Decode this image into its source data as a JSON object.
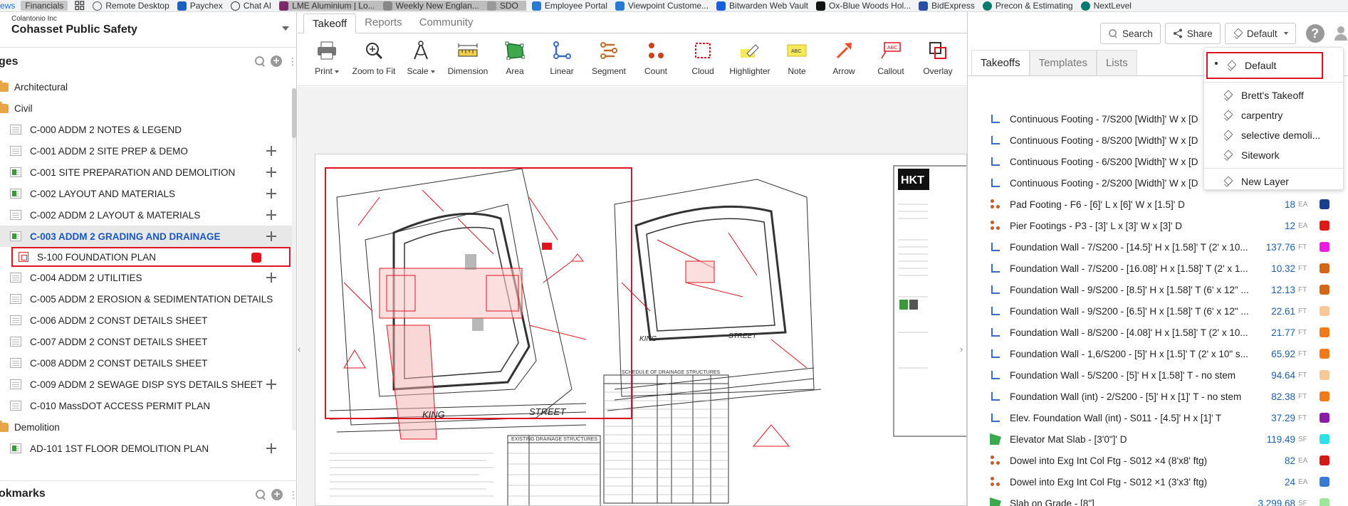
{
  "bookmarks": {
    "left_fragment": "ews",
    "items": [
      {
        "label": "Financials",
        "selected": true
      },
      {
        "label": "Remote Desktop"
      },
      {
        "label": "Paychex"
      },
      {
        "label": "Chat AI"
      },
      {
        "label": "LME Aluminium | Lo..."
      },
      {
        "label": "Weekly New Englan..."
      },
      {
        "label": "SDO"
      },
      {
        "label": "Employee Portal"
      },
      {
        "label": "Viewpoint Custome..."
      },
      {
        "label": "Bitwarden Web Vault"
      },
      {
        "label": "Ox-Blue Woods Hol..."
      },
      {
        "label": "BidExpress"
      },
      {
        "label": "Precon & Estimating"
      },
      {
        "label": "NextLevel"
      }
    ]
  },
  "project": {
    "company": "Colantonio Inc",
    "name": "Cohasset Public Safety"
  },
  "pages_section": {
    "title": "ges"
  },
  "bookmarks_section": {
    "title": "okmarks"
  },
  "pages": [
    {
      "type": "folder",
      "label": "Architectural"
    },
    {
      "type": "folder",
      "label": "Civil"
    },
    {
      "type": "sheet",
      "label": "C-000 ADDM 2 NOTES & LEGEND",
      "green": false,
      "move": false
    },
    {
      "type": "sheet",
      "label": "C-001 ADDM 2 SITE PREP & DEMO",
      "green": false,
      "move": true
    },
    {
      "type": "sheet",
      "label": "C-001 SITE PREPARATION AND DEMOLITION",
      "green": true,
      "move": true
    },
    {
      "type": "sheet",
      "label": "C-002 LAYOUT AND MATERIALS",
      "green": true,
      "move": true
    },
    {
      "type": "sheet",
      "label": "C-002 ADDM 2 LAYOUT & MATERIALS",
      "green": false,
      "move": true
    },
    {
      "type": "sheet",
      "label": "C-003 ADDM 2 GRADING AND DRAINAGE",
      "green": true,
      "move": true,
      "selected": true
    },
    {
      "type": "sub",
      "label": "S-100 FOUNDATION PLAN"
    },
    {
      "type": "sheet",
      "label": "C-004 ADDM 2 UTILITIES",
      "green": false,
      "move": true
    },
    {
      "type": "sheet",
      "label": "C-005 ADDM 2 EROSION & SEDIMENTATION DETAILS",
      "green": false,
      "move": false
    },
    {
      "type": "sheet",
      "label": "C-006 ADDM 2 CONST DETAILS SHEET",
      "green": false,
      "move": false
    },
    {
      "type": "sheet",
      "label": "C-007 ADDM 2 CONST DETAILS SHEET",
      "green": false,
      "move": false
    },
    {
      "type": "sheet",
      "label": "C-008 ADDM 2 CONST DETAILS SHEET",
      "green": false,
      "move": false
    },
    {
      "type": "sheet",
      "label": "C-009 ADDM 2 SEWAGE DISP SYS DETAILS SHEET",
      "green": false,
      "move": true
    },
    {
      "type": "sheet",
      "label": "C-010 MassDOT ACCESS PERMIT PLAN",
      "green": false,
      "move": false
    },
    {
      "type": "folder",
      "label": "Demolition"
    },
    {
      "type": "sheet",
      "label": "AD-101 1ST FLOOR DEMOLITION PLAN",
      "green": true,
      "move": true
    }
  ],
  "main_tabs": [
    {
      "label": "Takeoff",
      "active": true
    },
    {
      "label": "Reports"
    },
    {
      "label": "Community"
    }
  ],
  "tools": [
    {
      "label": "Print",
      "icon": "printer-icon",
      "caret": true
    },
    {
      "label": "Zoom to Fit",
      "icon": "zoom-icon"
    },
    {
      "label": "Scale",
      "icon": "compass-icon",
      "caret": true
    },
    {
      "label": "Dimension",
      "icon": "ruler-icon"
    },
    {
      "label": "Area",
      "icon": "area-icon"
    },
    {
      "label": "Linear",
      "icon": "linear-icon"
    },
    {
      "label": "Segment",
      "icon": "segment-icon"
    },
    {
      "label": "Count",
      "icon": "count-icon"
    },
    {
      "label": "Cloud",
      "icon": "cloud-icon"
    },
    {
      "label": "Highlighter",
      "icon": "highlighter-icon"
    },
    {
      "label": "Note",
      "icon": "note-icon"
    },
    {
      "label": "Arrow",
      "icon": "arrow-icon"
    },
    {
      "label": "Callout",
      "icon": "callout-icon"
    },
    {
      "label": "Overlay",
      "icon": "overlay-icon"
    }
  ],
  "drawing": {
    "logo": "HKT",
    "street1": "KING",
    "street2": "STREET",
    "street3": "KING",
    "street4": "STREET",
    "schedule_title": "SCHEDULE OF DRAINAGE STRUCTURES",
    "existing_title": "EXISTING DRAINAGE STRUCTURES"
  },
  "header": {
    "search": "Search",
    "share": "Share",
    "layer": "Default",
    "help": "?"
  },
  "right_tabs": [
    {
      "label": "Takeoffs",
      "active": true
    },
    {
      "label": "Templates"
    },
    {
      "label": "Lists"
    }
  ],
  "takeoffs": [
    {
      "icon": "linear",
      "name": "Continuous Footing - 7/S200 [Width]' W x [D",
      "qty": "",
      "unit": "",
      "color": ""
    },
    {
      "icon": "linear",
      "name": "Continuous Footing - 8/S200 [Width]' W x [D",
      "qty": "",
      "unit": "",
      "color": ""
    },
    {
      "icon": "linear",
      "name": "Continuous Footing - 6/S200 [Width]' W x [D",
      "qty": "",
      "unit": "",
      "color": ""
    },
    {
      "icon": "linear",
      "name": "Continuous Footing - 2/S200 [Width]' W x [D",
      "qty": "",
      "unit": "",
      "color": ""
    },
    {
      "icon": "count",
      "name": "Pad Footing - F6 - [6]' L x [6]' W x [1.5]' D",
      "qty": "18",
      "unit": "EA",
      "color": "#1a3f8f"
    },
    {
      "icon": "count",
      "name": "Pier Footings - P3 - [3]' L x [3]' W x [3]' D",
      "qty": "12",
      "unit": "EA",
      "color": "#e01818"
    },
    {
      "icon": "linear",
      "name": "Foundation Wall - 7/S200 - [14.5]' H x [1.58]' T (2' x 10...",
      "qty": "137.76",
      "unit": "FT",
      "color": "#e81ee0"
    },
    {
      "icon": "linear",
      "name": "Foundation Wall - 7/S200 - [16.08]' H x [1.58]' T (2' x 1...",
      "qty": "10.32",
      "unit": "FT",
      "color": "#d4661a"
    },
    {
      "icon": "linear",
      "name": "Foundation Wall - 9/S200 - [8.5]' H x [1.58]' T (6' x 12\" ...",
      "qty": "12.13",
      "unit": "FT",
      "color": "#d4661a"
    },
    {
      "icon": "linear",
      "name": "Foundation Wall - 9/S200 - [6.5]' H x [1.58]' T (6' x 12\" ...",
      "qty": "22.61",
      "unit": "FT",
      "color": "#f7c99a"
    },
    {
      "icon": "linear",
      "name": "Foundation Wall - 8/S200 - [4.08]' H x [1.58]' T (2' x 10...",
      "qty": "21.77",
      "unit": "FT",
      "color": "#ef7a1a"
    },
    {
      "icon": "linear",
      "name": "Foundation Wall - 1,6/S200 - [5]' H x [1.5]' T (2' x 10\" s...",
      "qty": "65.92",
      "unit": "FT",
      "color": "#ef7a1a"
    },
    {
      "icon": "linear",
      "name": "Foundation Wall - 5/S200 - [5]' H x [1.58]' T - no stem",
      "qty": "94.64",
      "unit": "FT",
      "color": "#f7c99a"
    },
    {
      "icon": "linear",
      "name": "Foundation Wall (int) - 2/S200 - [5]' H x [1]' T - no stem",
      "qty": "82.38",
      "unit": "FT",
      "color": "#ef7a1a"
    },
    {
      "icon": "linear",
      "name": "Elev. Foundation Wall (int) - S011 - [4.5]' H x [1]' T",
      "qty": "37.29",
      "unit": "FT",
      "color": "#8a1aa8"
    },
    {
      "icon": "area",
      "name": "Elevator Mat Slab - [3'0\"]' D",
      "qty": "119.49",
      "unit": "SF",
      "color": "#2ee0e8"
    },
    {
      "icon": "count",
      "name": "Dowel into Exg Int Col Ftg - S012 ×4 (8'x8' ftg)",
      "qty": "82",
      "unit": "EA",
      "color": "#d41818"
    },
    {
      "icon": "count",
      "name": "Dowel into Exg Int Col Ftg - S012 ×1 (3'x3' ftg)",
      "qty": "24",
      "unit": "EA",
      "color": "#3a7ad4"
    },
    {
      "icon": "area",
      "name": "Slab on Grade - [8\"]",
      "qty": "3,299.68",
      "unit": "SF",
      "color": "#9be89b"
    }
  ],
  "dropdown": {
    "items": [
      "Default",
      "Brett's Takeoff",
      "carpentry",
      "selective demoli...",
      "Sitework"
    ],
    "new_layer": "New Layer"
  }
}
